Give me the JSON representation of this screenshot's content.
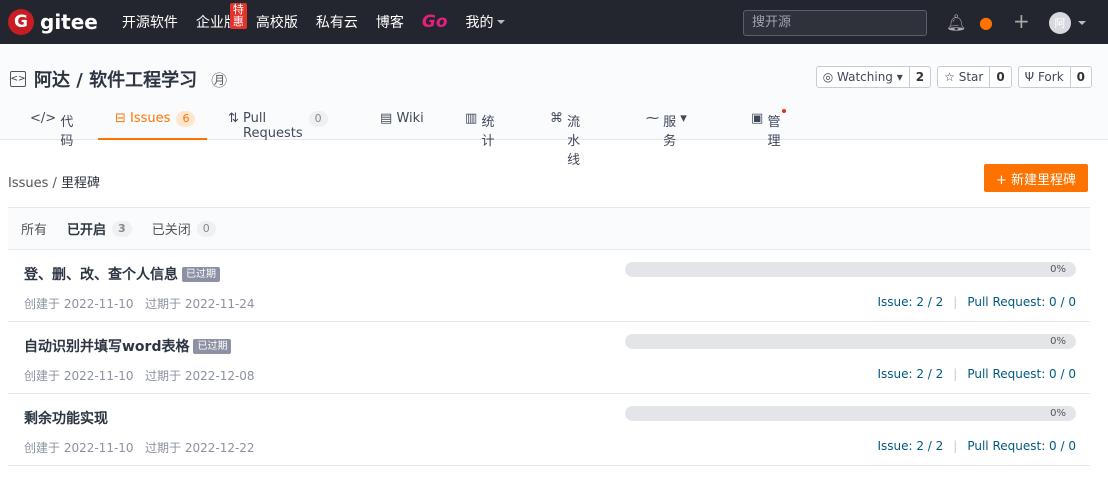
{
  "topbar": {
    "logo_letter": "G",
    "logo_text": "gitee",
    "nav": [
      "开源软件",
      "企业版",
      "高校版",
      "私有云",
      "博客"
    ],
    "special_tag": "特惠",
    "go_label": "Go",
    "mine_label": "我的",
    "search_placeholder": "搜开源",
    "avatar_text": "阿"
  },
  "repo": {
    "title": "阿达 / 软件工程学习",
    "watching_label": "Watching",
    "watching_count": "2",
    "star_label": "Star",
    "star_count": "0",
    "fork_label": "Fork",
    "fork_count": "0"
  },
  "tabs": [
    {
      "icon": "</>",
      "label": "代码"
    },
    {
      "icon": "⊟",
      "label": "Issues",
      "count": "6"
    },
    {
      "icon": "⇅",
      "label": "Pull Requests",
      "count": "0"
    },
    {
      "icon": "▤",
      "label": "Wiki"
    },
    {
      "icon": "▥",
      "label": "统计"
    },
    {
      "icon": "⌘",
      "label": "流水线"
    },
    {
      "icon": "⁓",
      "label": "服务"
    },
    {
      "icon": "▣",
      "label": "管理"
    }
  ],
  "breadcrumb": {
    "parent": "Issues",
    "sep": " / ",
    "current": "里程碑"
  },
  "new_button": "+ 新建里程碑",
  "filters": [
    {
      "label": "所有"
    },
    {
      "label": "已开启",
      "count": "3"
    },
    {
      "label": "已关闭",
      "count": "0"
    }
  ],
  "milestones": [
    {
      "title": "登、删、改、查个人信息",
      "overdue": "已过期",
      "created": "创建于 2022-11-10",
      "due": "过期于 2022-11-24",
      "progress": 0,
      "progress_label": "0%",
      "issue": "Issue: 2 / 2",
      "pr": "Pull Request: 0 / 0"
    },
    {
      "title": "自动识别并填写word表格",
      "overdue": "已过期",
      "created": "创建于 2022-11-10",
      "due": "过期于 2022-12-08",
      "progress": 0,
      "progress_label": "0%",
      "issue": "Issue: 2 / 2",
      "pr": "Pull Request: 0 / 0"
    },
    {
      "title": "剩余功能实现",
      "overdue": "",
      "created": "创建于 2022-11-10",
      "due": "过期于 2022-12-22",
      "progress": 0,
      "progress_label": "0%",
      "issue": "Issue: 2 / 2",
      "pr": "Pull Request: 0 / 0"
    }
  ],
  "colors": {
    "accent": "#fe7300",
    "topbar": "#23262e",
    "link": "#005980"
  }
}
